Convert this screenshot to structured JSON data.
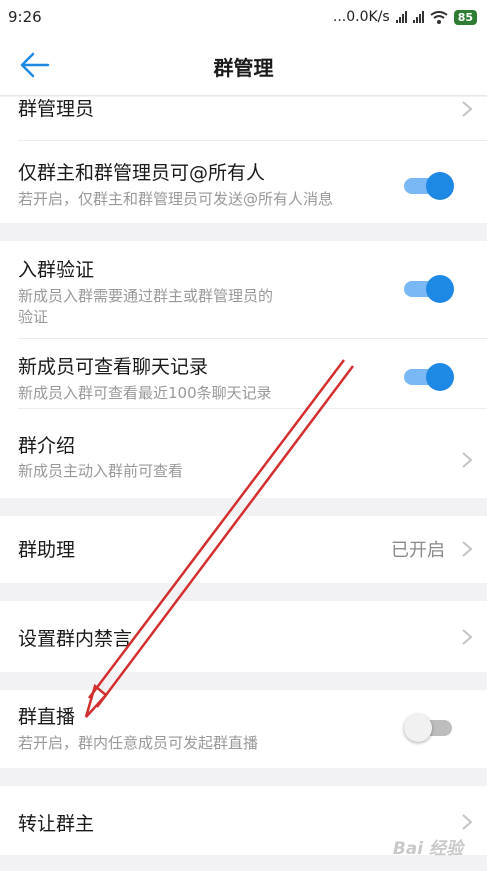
{
  "status": {
    "time": "9:26",
    "speed": "...0.0K/s",
    "battery": "85"
  },
  "header": {
    "title": "群管理"
  },
  "rows": {
    "admins": {
      "label": "群管理员"
    },
    "at_all": {
      "label": "仅群主和群管理员可@所有人",
      "desc": "若开启，仅群主和群管理员可发送@所有人消息",
      "toggle": true
    },
    "verify": {
      "label": "入群验证",
      "desc": "新成员入群需要通过群主或群管理员的\n验证",
      "toggle": true
    },
    "history": {
      "label": "新成员可查看聊天记录",
      "desc": "新成员入群可查看最近100条聊天记录",
      "toggle": true
    },
    "intro": {
      "label": "群介绍",
      "desc": "新成员主动入群前可查看"
    },
    "assistant": {
      "label": "群助理",
      "value": "已开启"
    },
    "mute": {
      "label": "设置群内禁言"
    },
    "live": {
      "label": "群直播",
      "desc": "若开启，群内任意成员可发起群直播",
      "toggle": false
    },
    "transfer": {
      "label": "转让群主"
    }
  },
  "watermark": "Bai 经验",
  "colors": {
    "accent": "#1e88e5",
    "annotation_arrow": "#d32f2f"
  }
}
